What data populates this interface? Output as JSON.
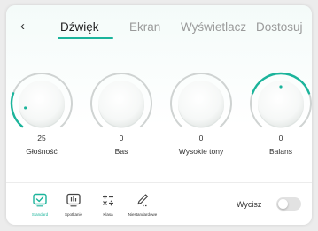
{
  "header": {
    "back_icon": "chevron-left-icon",
    "tabs": [
      {
        "label": "Dźwięk",
        "active": true
      },
      {
        "label": "Ekran",
        "active": false
      },
      {
        "label": "Wyświetlacz",
        "active": false
      },
      {
        "label": "Dostosuj",
        "active": false
      }
    ]
  },
  "knobs": [
    {
      "value": "25",
      "label": "Głośność",
      "level": 0.25,
      "range": [
        0,
        100
      ],
      "mode": "from-min"
    },
    {
      "value": "0",
      "label": "Bas",
      "level": 0,
      "range": [
        -50,
        50
      ],
      "mode": "center"
    },
    {
      "value": "0",
      "label": "Wysokie tony",
      "level": 0,
      "range": [
        -50,
        50
      ],
      "mode": "center"
    },
    {
      "value": "0",
      "label": "Balans",
      "level": 0,
      "range": [
        -50,
        50
      ],
      "mode": "center-arc"
    }
  ],
  "modes": [
    {
      "label": "Standard",
      "icon": "check-square-icon",
      "active": true
    },
    {
      "label": "Spotkanie",
      "icon": "equalizer-icon",
      "active": false
    },
    {
      "label": "Klasa",
      "icon": "math-operators-icon",
      "active": false
    },
    {
      "label": "Niestandardowe",
      "icon": "pen-icon",
      "active": false
    }
  ],
  "mute": {
    "label": "Wycisz",
    "on": false
  },
  "colors": {
    "accent": "#1bb49b",
    "inactive": "#9a9a9a",
    "text": "#333333"
  }
}
